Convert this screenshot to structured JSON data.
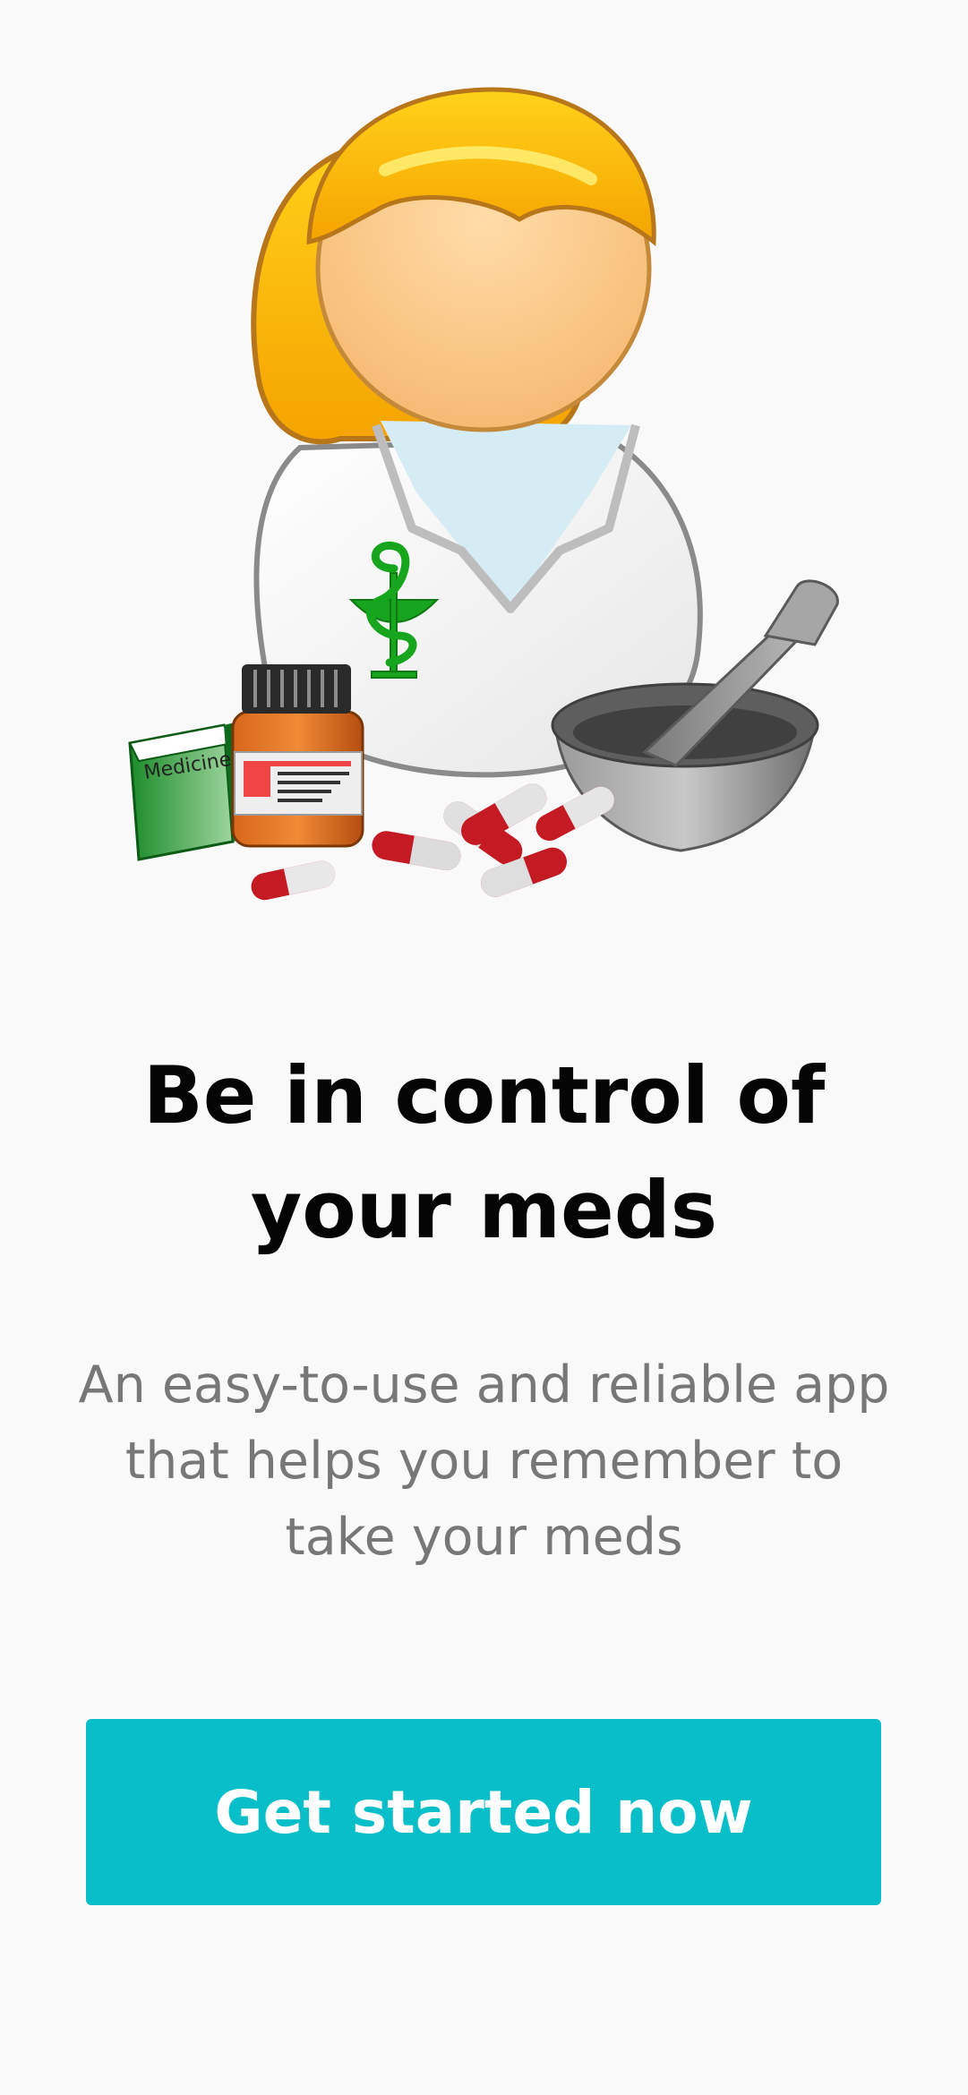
{
  "illustration": {
    "icon": "pharmacist-illustration",
    "medicine_box_label": "Medicine"
  },
  "headline": "Be in control of your meds",
  "subtext": "An easy-to-use and reliable app that helps you remember to take your meds",
  "cta": {
    "label": "Get started now",
    "color": "#08bec8"
  }
}
